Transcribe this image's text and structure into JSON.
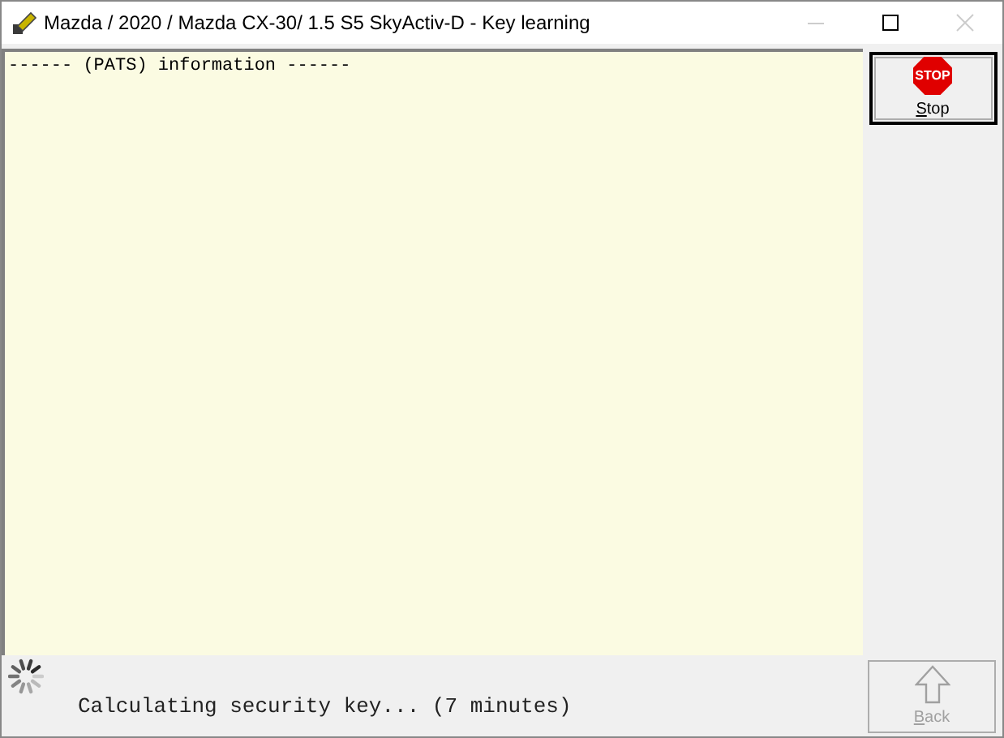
{
  "window": {
    "title": "Mazda / 2020 / Mazda CX-30/ 1.5 S5 SkyActiv-D - Key learning"
  },
  "log": {
    "lines": [
      "------ (PATS) information ------"
    ]
  },
  "buttons": [
    {
      "kind": "stop",
      "sign": "STOP",
      "access_key": "S",
      "label_rest": "top",
      "disabled": false
    },
    {
      "kind": "back",
      "access_key": "B",
      "label_rest": "ack",
      "disabled": true
    }
  ],
  "status": {
    "text": "Calculating security key... (7 minutes)",
    "busy": true
  }
}
